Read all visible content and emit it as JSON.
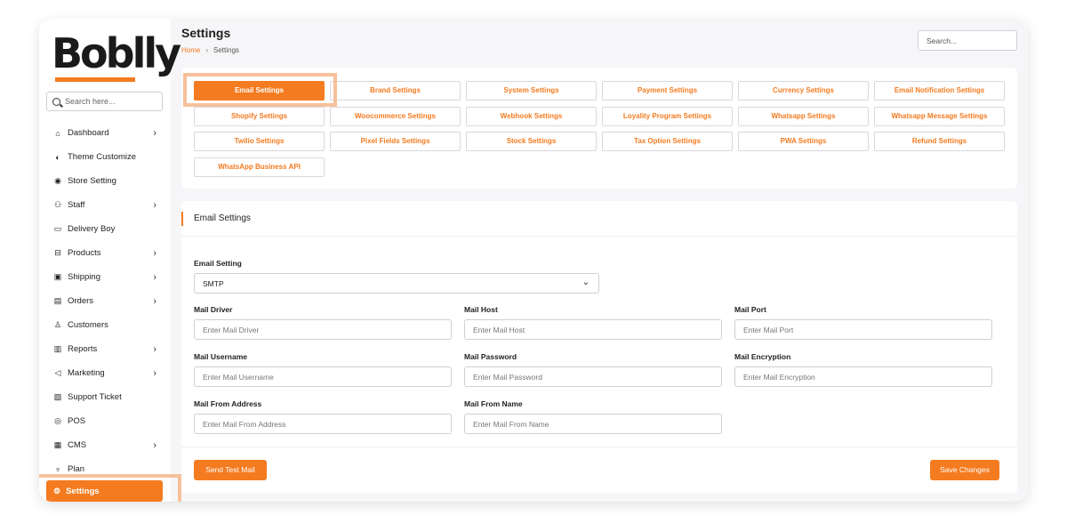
{
  "brand": {
    "logo_text": "Boblly",
    "accent": "#f47b20"
  },
  "sidebar": {
    "search_placeholder": "Search here...",
    "items": [
      {
        "label": "Dashboard",
        "icon": "home-icon",
        "chevron": true
      },
      {
        "label": "Theme Customize",
        "icon": "brush-icon",
        "chevron": false
      },
      {
        "label": "Store Setting",
        "icon": "store-icon",
        "chevron": false
      },
      {
        "label": "Staff",
        "icon": "users-icon",
        "chevron": true
      },
      {
        "label": "Delivery Boy",
        "icon": "truck-icon",
        "chevron": false
      },
      {
        "label": "Products",
        "icon": "cart-icon",
        "chevron": true
      },
      {
        "label": "Shipping",
        "icon": "shipping-icon",
        "chevron": true
      },
      {
        "label": "Orders",
        "icon": "orders-icon",
        "chevron": true
      },
      {
        "label": "Customers",
        "icon": "customer-icon",
        "chevron": false
      },
      {
        "label": "Reports",
        "icon": "chart-icon",
        "chevron": true
      },
      {
        "label": "Marketing",
        "icon": "megaphone-icon",
        "chevron": true
      },
      {
        "label": "Support Ticket",
        "icon": "ticket-icon",
        "chevron": false
      },
      {
        "label": "POS",
        "icon": "pos-icon",
        "chevron": false
      },
      {
        "label": "CMS",
        "icon": "cms-icon",
        "chevron": true
      },
      {
        "label": "Plan",
        "icon": "trophy-icon",
        "chevron": false
      }
    ],
    "active_item": {
      "label": "Settings",
      "icon": "gear-icon"
    }
  },
  "header": {
    "title": "Settings",
    "breadcrumb_home": "Home",
    "breadcrumb_current": "Settings",
    "search_placeholder": "Search..."
  },
  "tabs": [
    "Email Settings",
    "Brand Settings",
    "System Settings",
    "Payment Settings",
    "Currency Settings",
    "Email Notification Settings",
    "Shopify Settings",
    "Woocommerce Settings",
    "Webhook Settings",
    "Loyality Program Settings",
    "Whatsapp Settings",
    "Whatsapp Message Settings",
    "Twilio Settings",
    "Pixel Fields Settings",
    "Stock Settings",
    "Tax Option Settings",
    "PWA Settings",
    "Refund Settings",
    "WhatsApp Business API"
  ],
  "active_tab": "Email Settings",
  "email_card": {
    "title": "Email Settings",
    "setting_label": "Email Setting",
    "setting_value": "SMTP",
    "fields": [
      {
        "label": "Mail Driver",
        "placeholder": "Enter Mail Driver"
      },
      {
        "label": "Mail Host",
        "placeholder": "Enter Mail Host"
      },
      {
        "label": "Mail Port",
        "placeholder": "Enter Mail Port"
      },
      {
        "label": "Mail Username",
        "placeholder": "Enter Mail Username"
      },
      {
        "label": "Mail Password",
        "placeholder": "Enter Mail Password"
      },
      {
        "label": "Mail Encryption",
        "placeholder": "Enter Mail Encryption"
      },
      {
        "label": "Mail From Address",
        "placeholder": "Enter Mail From Address"
      },
      {
        "label": "Mail From Name",
        "placeholder": "Enter Mail From Name"
      }
    ],
    "send_test_label": "Send Test Mail",
    "save_label": "Save Changes"
  }
}
